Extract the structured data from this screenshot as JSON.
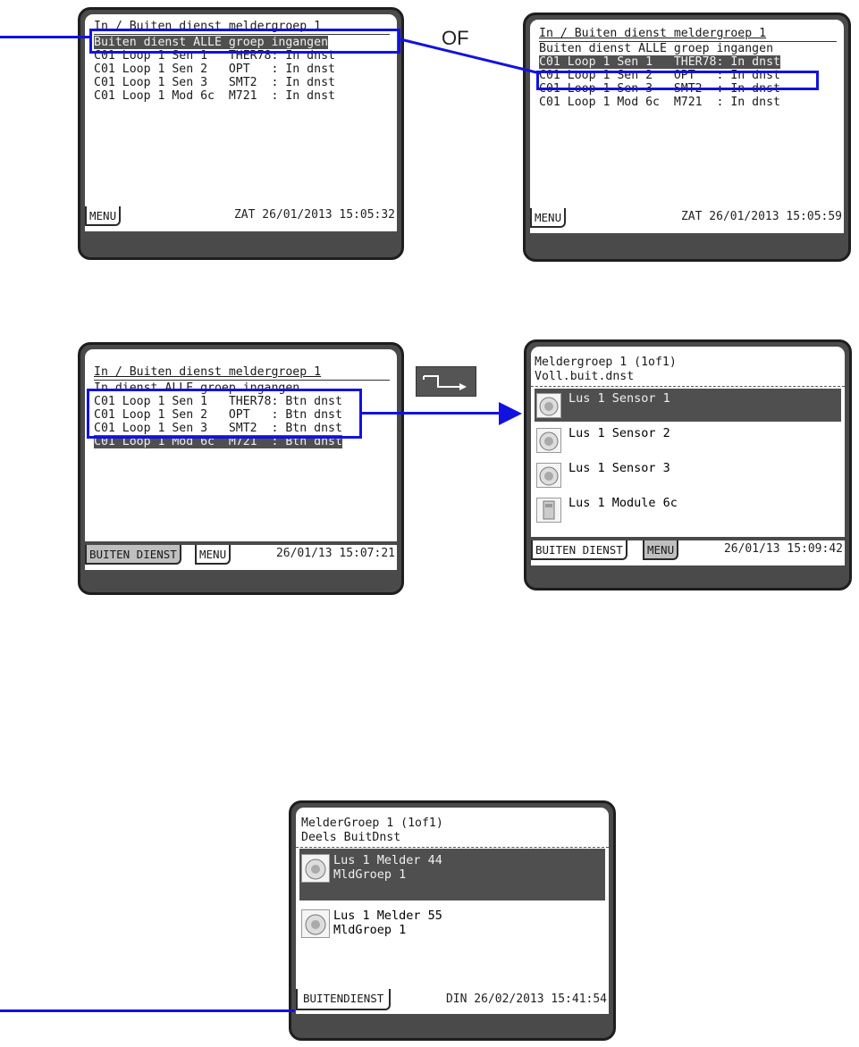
{
  "p1": {
    "title": "In / Buiten dienst meldergroep 1",
    "lines": [
      "Buiten dienst ALLE groep ingangen",
      "C01 Loop 1 Sen 1   THER78: In dnst",
      "C01 Loop 1 Sen 2   OPT   : In dnst",
      "C01 Loop 1 Sen 3   SMT2  : In dnst",
      "C01 Loop 1 Mod 6c  M721  : In dnst"
    ],
    "tab": "MENU",
    "stamp": "ZAT 26/01/2013 15:05:32"
  },
  "or_label": "OF",
  "p2": {
    "title": "In / Buiten dienst meldergroep 1",
    "lines": [
      "Buiten dienst ALLE groep ingangen",
      "C01 Loop 1 Sen 1   THER78: In dnst",
      "C01 Loop 1 Sen 2   OPT   : In dnst",
      "C01 Loop 1 Sen 3   SMT2  : In dnst",
      "C01 Loop 1 Mod 6c  M721  : In dnst"
    ],
    "tab": "MENU",
    "stamp": "ZAT 26/01/2013 15:05:59"
  },
  "p3": {
    "title": "In / Buiten dienst meldergroep 1",
    "lines": [
      "In dienst ALLE groep ingangen",
      "C01 Loop 1 Sen 1   THER78: Btn dnst",
      "C01 Loop 1 Sen 2   OPT   : Btn dnst",
      "C01 Loop 1 Sen 3   SMT2  : Btn dnst",
      "C01 Loop 1 Mod 6c  M721  : Btn dnst"
    ],
    "tab1": "BUITEN DIENST",
    "tab2": "MENU",
    "stamp": "26/01/13 15:07:21"
  },
  "p4": {
    "title1": "Meldergroep 1 (1of1)",
    "title2": "Voll.buit.dnst",
    "items": [
      "Lus 1 Sensor 1",
      "Lus 1 Sensor 2",
      "Lus 1 Sensor 3",
      "Lus 1 Module 6c"
    ],
    "icons": [
      "detector-icon",
      "detector-icon",
      "detector-icon",
      "module-icon"
    ],
    "tab1": "BUITEN DIENST",
    "tab2": "MENU",
    "stamp": "26/01/13 15:09:42"
  },
  "p5": {
    "title1": "MelderGroep 1 (1of1)",
    "title2": "Deels BuitDnst",
    "items": [
      {
        "l1": "Lus 1 Melder 44",
        "l2": "MldGroep 1"
      },
      {
        "l1": "Lus 1 Melder 55",
        "l2": "MldGroep 1"
      }
    ],
    "tab": "BUITENDIENST",
    "stamp": "DIN 26/02/2013 15:41:54"
  },
  "colors": {
    "annotation": "#1212e0",
    "panel": "#4a4a4a",
    "highlight": "#4f4f4f"
  }
}
